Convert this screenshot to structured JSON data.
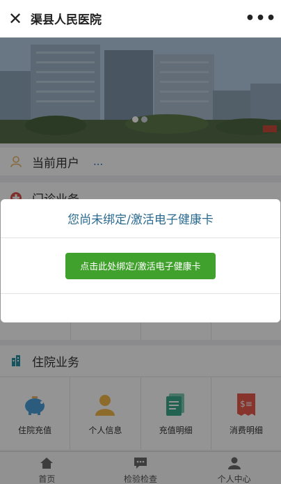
{
  "topbar": {
    "close_glyph": "✕",
    "title": "渠县人民医院",
    "more_glyph": "•••"
  },
  "banner": {
    "slide_count": 2,
    "active_slide": 1
  },
  "user_row": {
    "icon": "person-outline-icon",
    "label": "当前用户",
    "value": "..."
  },
  "outpatient": {
    "icon": "medical-cross-icon",
    "label": "门诊业务"
  },
  "inpatient": {
    "icon": "hospital-building-icon",
    "label": "住院业务",
    "items": [
      {
        "icon": "piggy-bank-icon",
        "label": "住院充值"
      },
      {
        "icon": "person-profile-icon",
        "label": "个人信息"
      },
      {
        "icon": "recharge-record-icon",
        "label": "充值明细"
      },
      {
        "icon": "receipt-icon",
        "label": "消费明细"
      }
    ]
  },
  "tabbar": [
    {
      "icon": "home-icon",
      "label": "首页"
    },
    {
      "icon": "chat-bubble-icon",
      "label": "检验检查"
    },
    {
      "icon": "user-icon",
      "label": "个人中心"
    }
  ],
  "modal": {
    "title": "您尚未绑定/激活电子健康卡",
    "button_label": "点击此处绑定/激活电子健康卡"
  },
  "colors": {
    "primary_button": "#40a12c",
    "modal_title": "#2a6a90",
    "link_blue": "#2b6cc4",
    "mask": "rgba(0,0,0,0.42)"
  }
}
